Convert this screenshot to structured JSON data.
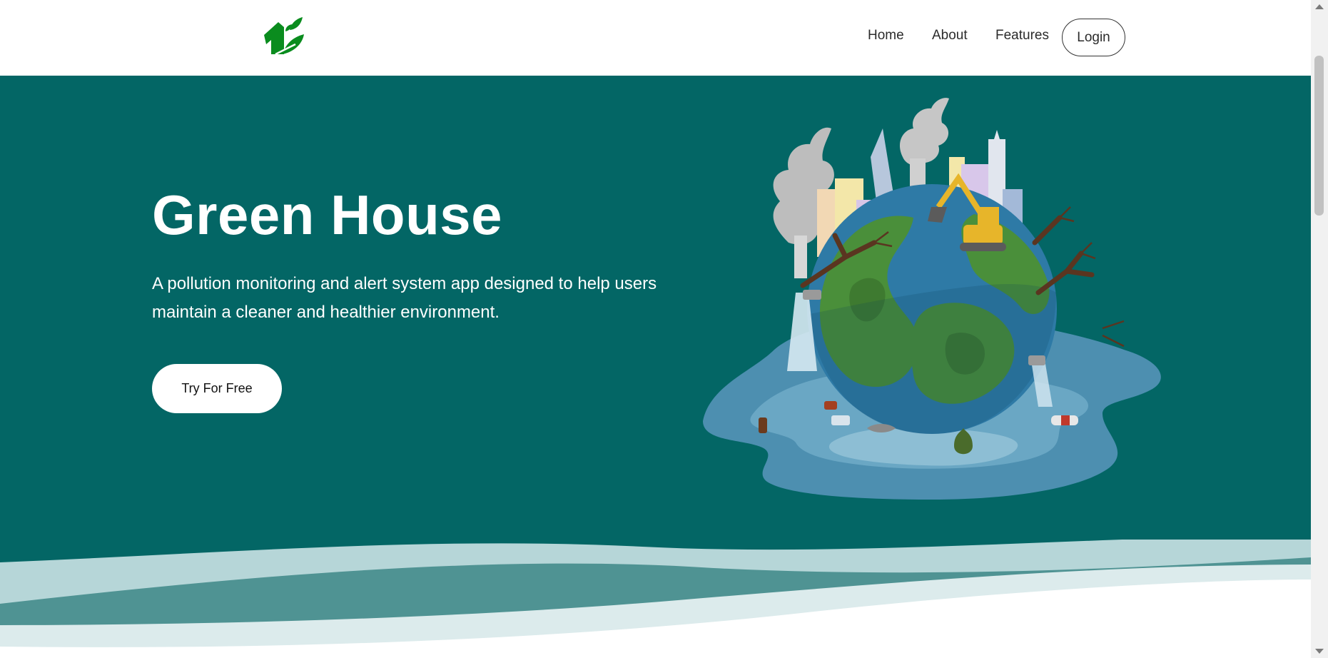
{
  "brand": {
    "logo_icon": "house-leaf-icon",
    "logo_color": "#0a8c1e"
  },
  "nav": {
    "items": [
      {
        "label": "Home"
      },
      {
        "label": "About"
      },
      {
        "label": "Features"
      }
    ],
    "login_label": "Login"
  },
  "hero": {
    "title": "Green House",
    "description": "A pollution monitoring and alert system app designed to help users maintain a cleaner and healthier environment.",
    "cta_label": "Try For Free",
    "background_color": "#036665",
    "illustration_icon": "polluted-earth-illustration"
  }
}
